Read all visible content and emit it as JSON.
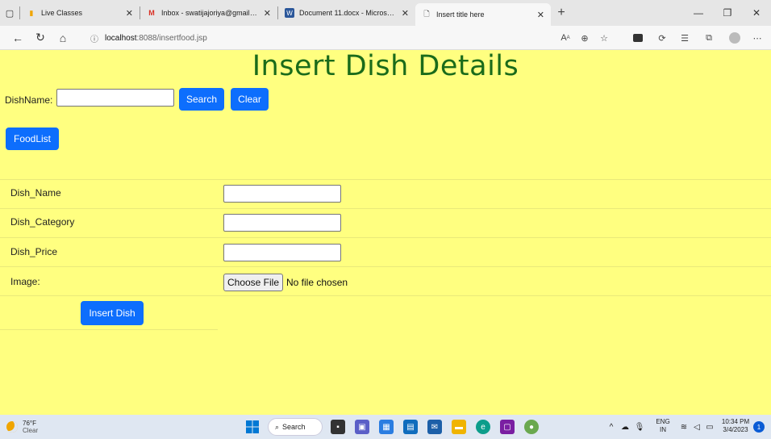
{
  "browser": {
    "tabs": [
      {
        "title": "Live Classes",
        "icon": "live-classes-icon"
      },
      {
        "title": "Inbox - swatijajoriya@gmail.com",
        "icon": "gmail-icon"
      },
      {
        "title": "Document 11.docx - Microsoft W",
        "icon": "word-icon"
      },
      {
        "title": "Insert title here",
        "icon": "page-icon",
        "active": true
      }
    ],
    "url_host": "localhost",
    "url_path": ":8088/insertfood.jsp"
  },
  "page": {
    "title": "Insert Dish Details",
    "search": {
      "label": "DishName:",
      "value": "",
      "search_button": "Search",
      "clear_button": "Clear"
    },
    "foodlist_button": "FoodList",
    "form": {
      "dish_name_label": "Dish_Name",
      "dish_category_label": "Dish_Category",
      "dish_price_label": "Dish_Price",
      "image_label": "Image:",
      "choose_file_button": "Choose File",
      "file_status": "No file chosen",
      "submit_button": "Insert Dish"
    },
    "colors": {
      "background": "#ffff80",
      "title": "#1a6b1a",
      "button": "#0d6efd"
    }
  },
  "taskbar": {
    "weather_temp": "76°F",
    "weather_desc": "Clear",
    "search_label": "Search",
    "lang_1": "ENG",
    "lang_2": "IN",
    "time": "10:34 PM",
    "date": "3/4/2023",
    "notification_count": "1"
  }
}
